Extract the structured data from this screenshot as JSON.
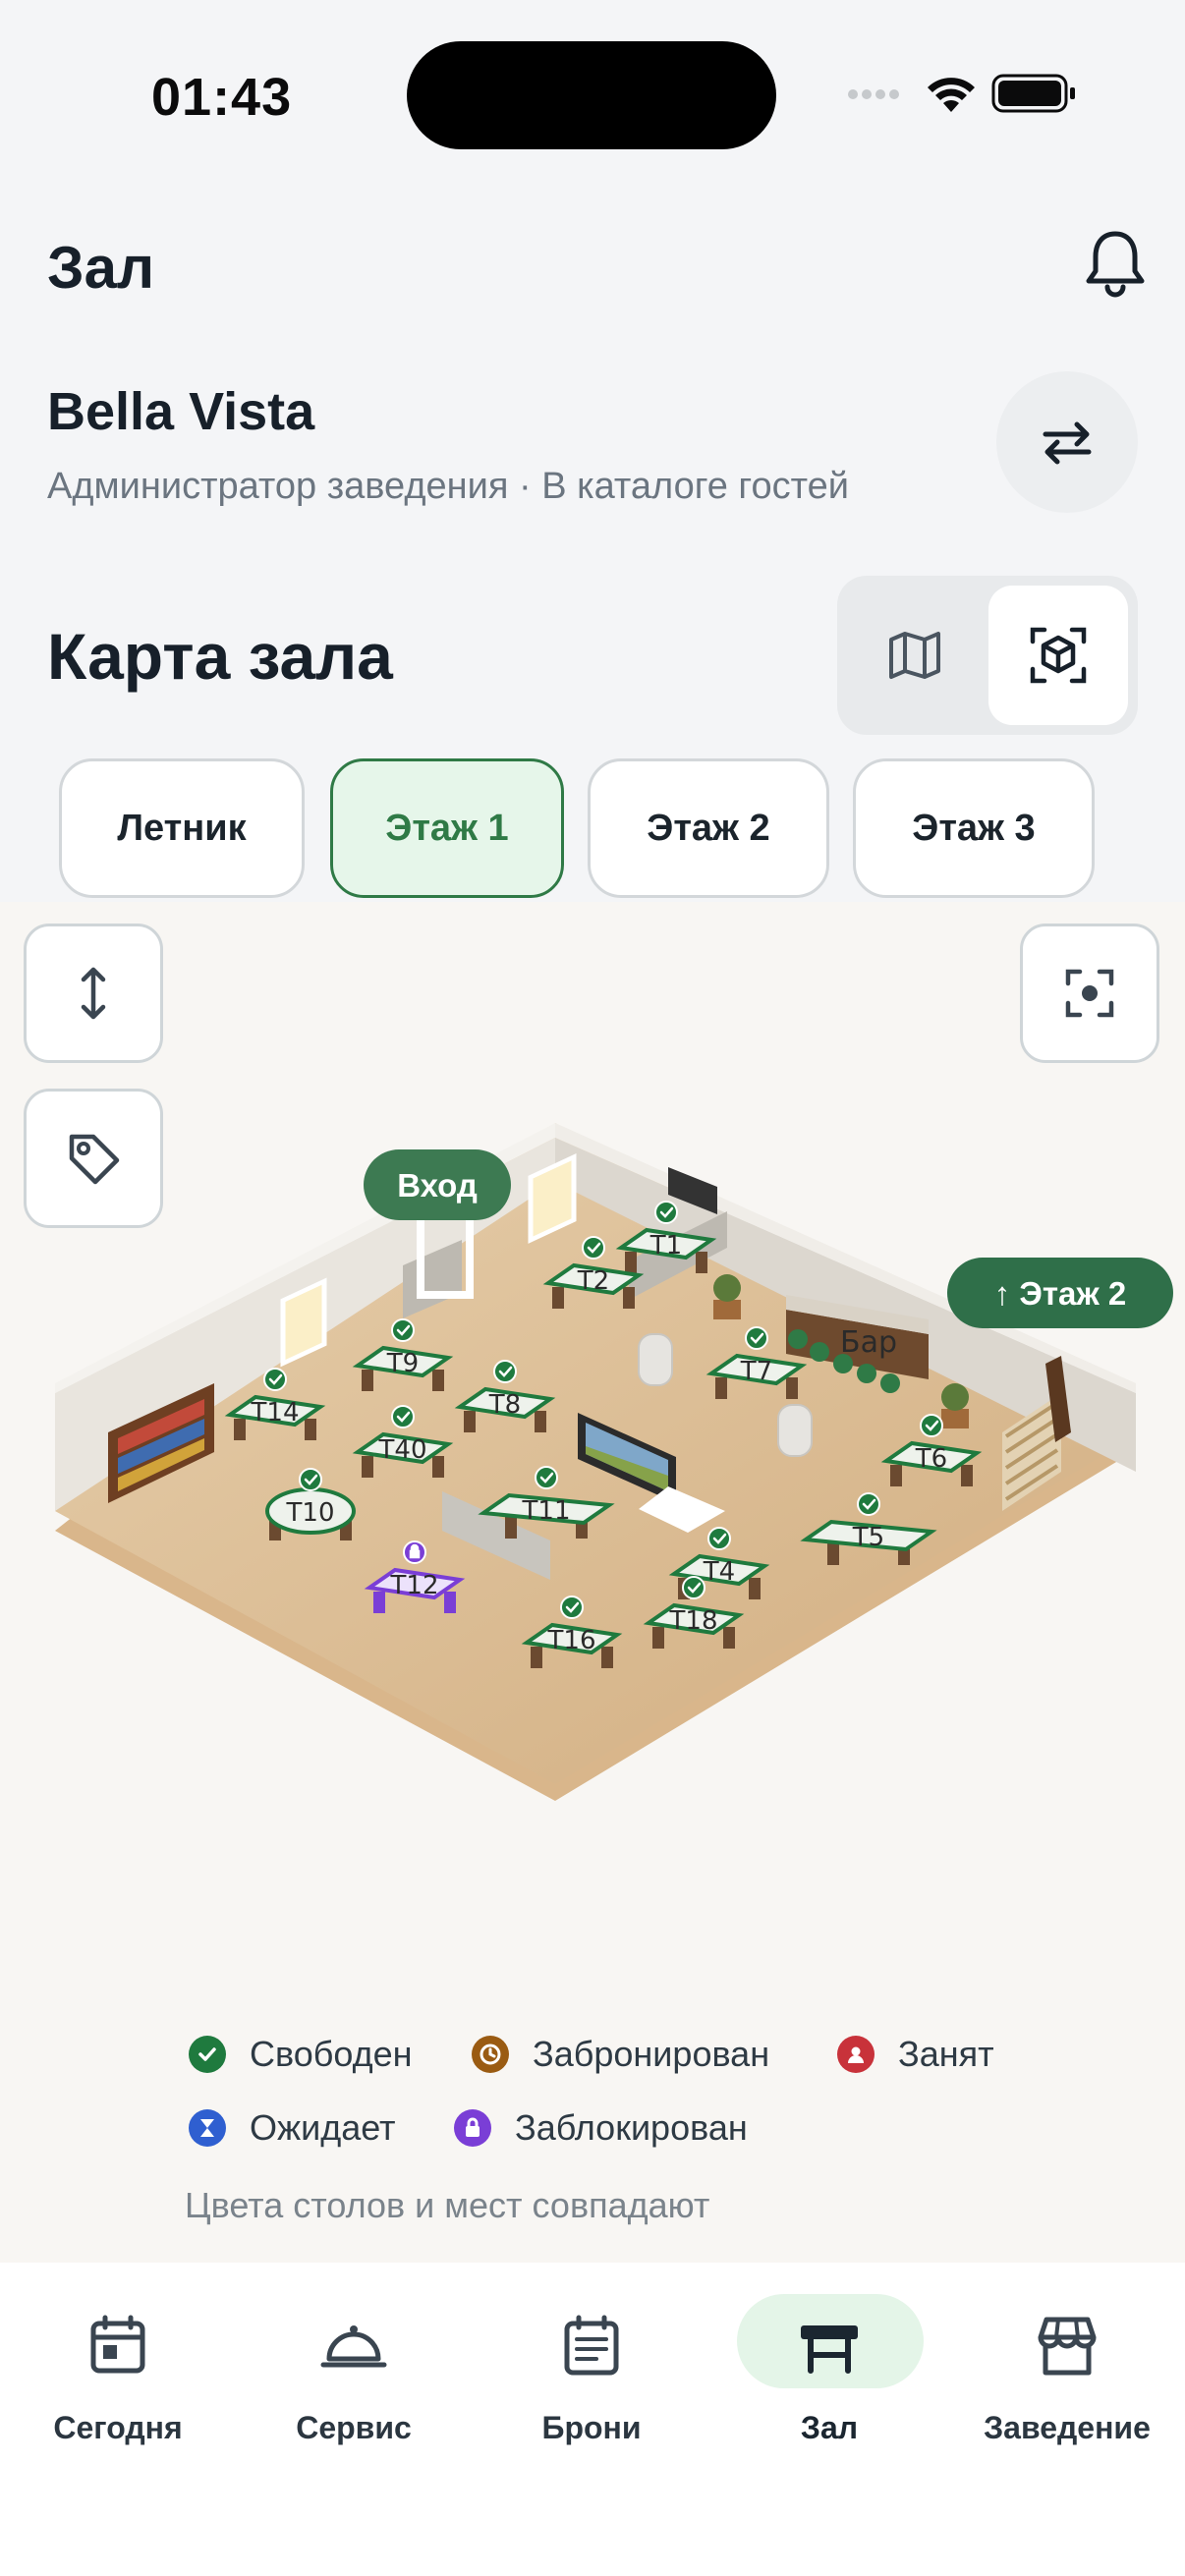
{
  "status": {
    "time": "01:43"
  },
  "header": {
    "title": "Зал"
  },
  "venue": {
    "name": "Bella Vista",
    "subtitle": "Администратор заведения · В каталоге гостей"
  },
  "map_section": {
    "title": "Карта зала"
  },
  "floors": [
    {
      "label": "Летник",
      "active": false
    },
    {
      "label": "Этаж 1",
      "active": true
    },
    {
      "label": "Этаж 2",
      "active": false
    },
    {
      "label": "Этаж 3",
      "active": false
    }
  ],
  "map": {
    "entrance_label": "Вход",
    "stairs_label": "↑ Этаж 2",
    "bar_label": "Бар",
    "tables": [
      {
        "label": "T1",
        "status": "free"
      },
      {
        "label": "T2",
        "status": "free"
      },
      {
        "label": "T4",
        "status": "free"
      },
      {
        "label": "T5",
        "status": "free"
      },
      {
        "label": "T6",
        "status": "free"
      },
      {
        "label": "T7",
        "status": "free"
      },
      {
        "label": "T8",
        "status": "free"
      },
      {
        "label": "T9",
        "status": "free"
      },
      {
        "label": "T10",
        "status": "free"
      },
      {
        "label": "T11",
        "status": "free"
      },
      {
        "label": "T12",
        "status": "blocked"
      },
      {
        "label": "T14",
        "status": "free"
      },
      {
        "label": "T16",
        "status": "free"
      },
      {
        "label": "T18",
        "status": "free"
      },
      {
        "label": "T40",
        "status": "free"
      }
    ]
  },
  "legend": {
    "items": [
      {
        "label": "Свободен",
        "color": "#1f7a3e",
        "icon": "check-icon"
      },
      {
        "label": "Забронирован",
        "color": "#9a5b12",
        "icon": "clock-icon"
      },
      {
        "label": "Занят",
        "color": "#c8323a",
        "icon": "person-icon"
      },
      {
        "label": "Ожидает",
        "color": "#2f5fd0",
        "icon": "hourglass-icon"
      },
      {
        "label": "Заблокирован",
        "color": "#7a3ed6",
        "icon": "lock-icon"
      }
    ],
    "note": "Цвета столов и мест совпадают"
  },
  "nav": [
    {
      "label": "Сегодня",
      "icon": "calendar-today-icon",
      "active": false
    },
    {
      "label": "Сервис",
      "icon": "cloche-icon",
      "active": false
    },
    {
      "label": "Брони",
      "icon": "bookings-calendar-icon",
      "active": false
    },
    {
      "label": "Зал",
      "icon": "table-icon",
      "active": true
    },
    {
      "label": "Заведение",
      "icon": "storefront-icon",
      "active": false
    }
  ],
  "colors": {
    "accent": "#2f7a46",
    "free": "#1f7a3e",
    "blocked": "#7a3ed6"
  }
}
